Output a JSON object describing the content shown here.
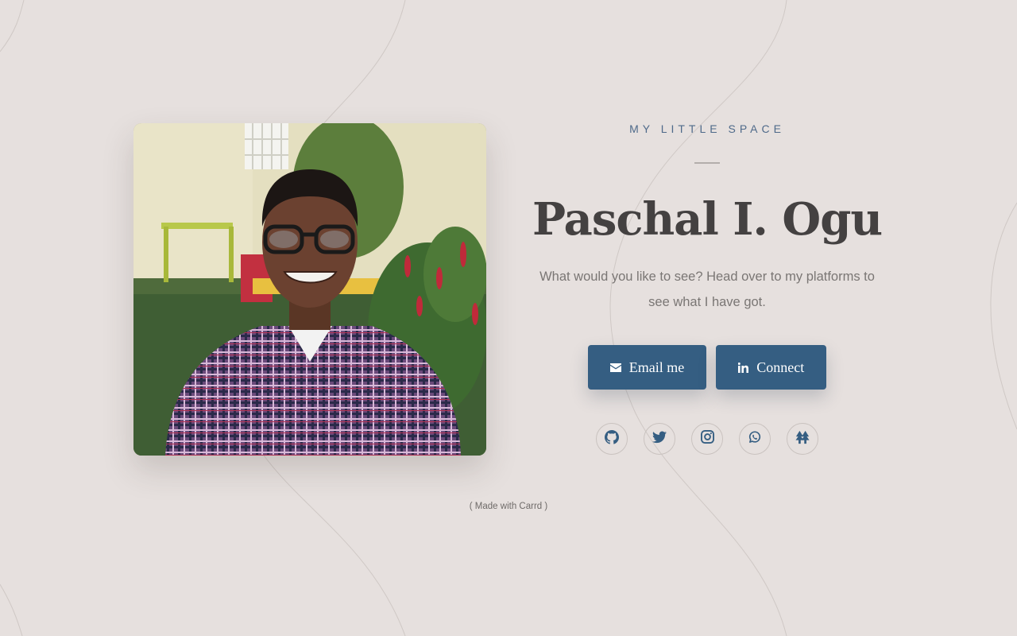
{
  "profile": {
    "eyebrow": "MY LITTLE SPACE",
    "name": "Paschal I. Ogu",
    "tagline": "What would you like to see? Head over to my platforms to see what I have got."
  },
  "buttons": {
    "email": {
      "label": "Email me",
      "icon": "envelope-icon"
    },
    "connect": {
      "label": "Connect",
      "icon": "linkedin-icon"
    }
  },
  "socials": [
    {
      "name": "github-icon"
    },
    {
      "name": "twitter-icon"
    },
    {
      "name": "instagram-icon"
    },
    {
      "name": "whatsapp-icon"
    },
    {
      "name": "linktree-icon"
    }
  ],
  "footer": {
    "text": "( Made with Carrd )"
  },
  "colors": {
    "background": "#e6e0de",
    "accent": "#355e82",
    "heading": "#444141",
    "body_text": "#7a7674",
    "eyebrow": "#4f6a8a"
  }
}
